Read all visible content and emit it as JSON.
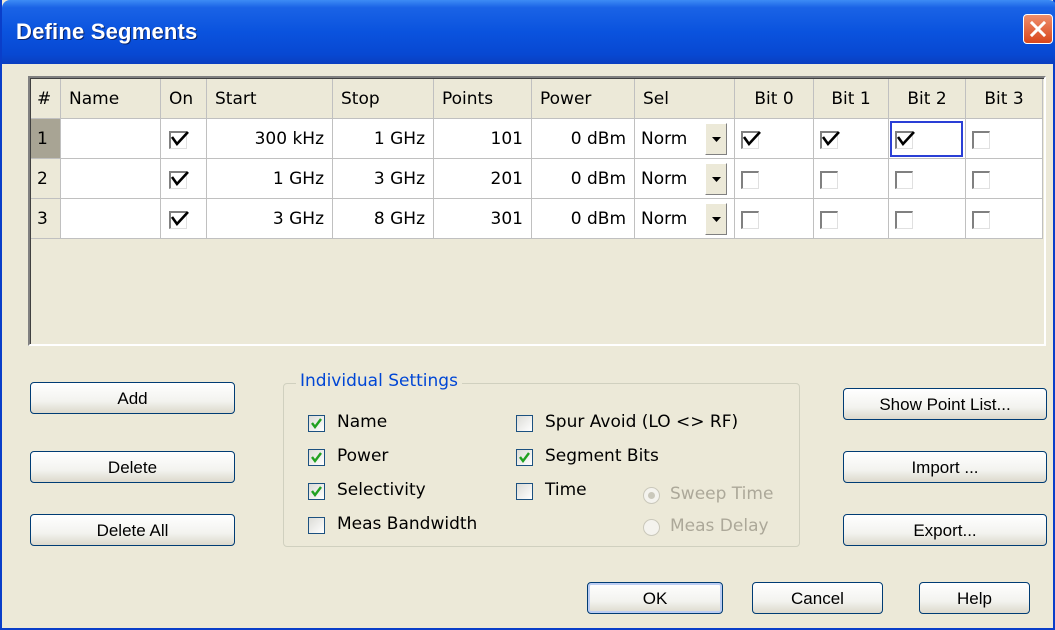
{
  "window": {
    "title": "Define Segments"
  },
  "grid": {
    "headers": [
      "#",
      "Name",
      "On",
      "Start",
      "Stop",
      "Points",
      "Power",
      "Sel",
      "Bit 0",
      "Bit 1",
      "Bit 2",
      "Bit 3"
    ],
    "rows": [
      {
        "num": "1",
        "name": "",
        "on": true,
        "start": "300 kHz",
        "stop": "1 GHz",
        "points": "101",
        "power": "0 dBm",
        "sel": "Norm",
        "bits": [
          true,
          true,
          true,
          false
        ]
      },
      {
        "num": "2",
        "name": "",
        "on": true,
        "start": "1 GHz",
        "stop": "3 GHz",
        "points": "201",
        "power": "0 dBm",
        "sel": "Norm",
        "bits": [
          false,
          false,
          false,
          false
        ]
      },
      {
        "num": "3",
        "name": "",
        "on": true,
        "start": "3 GHz",
        "stop": "8 GHz",
        "points": "301",
        "power": "0 dBm",
        "sel": "Norm",
        "bits": [
          false,
          false,
          false,
          false
        ]
      }
    ]
  },
  "buttons": {
    "add": "Add",
    "delete": "Delete",
    "delete_all": "Delete All",
    "show_point_list": "Show Point List...",
    "import": "Import ...",
    "export": "Export...",
    "ok": "OK",
    "cancel": "Cancel",
    "help": "Help"
  },
  "individual_settings": {
    "title": "Individual Settings",
    "name": {
      "label": "Name",
      "checked": true
    },
    "power": {
      "label": "Power",
      "checked": true
    },
    "selectivity": {
      "label": "Selectivity",
      "checked": true
    },
    "meas_bandwidth": {
      "label": "Meas Bandwidth",
      "checked": false
    },
    "spur_avoid": {
      "label": "Spur Avoid (LO <> RF)",
      "checked": false
    },
    "segment_bits": {
      "label": "Segment Bits",
      "checked": true
    },
    "time": {
      "label": "Time",
      "checked": false
    },
    "sweep_time": {
      "label": "Sweep Time",
      "selected": true,
      "enabled": false
    },
    "meas_delay": {
      "label": "Meas Delay",
      "selected": false,
      "enabled": false
    }
  },
  "colors": {
    "title_bar": "#0a53de",
    "group_title": "#0046d5",
    "focus": "#2a3fd6"
  }
}
